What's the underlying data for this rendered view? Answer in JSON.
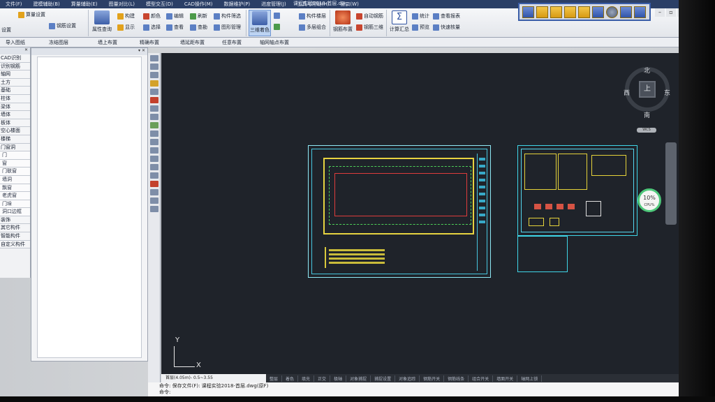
{
  "menu": {
    "items": [
      "文件(F)",
      "建模辅助(B)",
      "算量辅助(E)",
      "图量对比(L)",
      "模型交互(D)",
      "CAD操作(M)",
      "数据维护(P)",
      "进度管理(J)",
      "工具与帮助(H)",
      "窗口(W)"
    ],
    "file_title": "课程实验2018-首层.dwg"
  },
  "ribbon": {
    "buttons": [
      "算量设置",
      "钢筋设置",
      "属性查询",
      "构建",
      "显示",
      "颜色",
      "选择",
      "编辑",
      "查看",
      "刷新",
      "查勘",
      "构件筛选",
      "图形管理",
      "三维着色",
      "构件楼层",
      "多层组合",
      "钢筋布置",
      "自动钢筋",
      "钢筋三维",
      "计算汇总",
      "统计",
      "预览",
      "查看报表",
      "快速核量"
    ],
    "big_labels": {
      "attr": "属性查询",
      "color3d": "三维着色",
      "rebar": "钢筋布置",
      "calc": "计算汇总"
    },
    "left_label": "设置"
  },
  "toolrow": {
    "items": [
      "导入图纸",
      "冻结图层",
      "墙上布置",
      "精确布置",
      "墙延距布置",
      "任意布置",
      "轴网轴点布置"
    ]
  },
  "leftnav": {
    "items": [
      "CAD识别",
      "识别钢筋",
      "轴网",
      "土方",
      "基础",
      "柱体",
      "梁体",
      "墙体",
      "板体",
      "空心楼面",
      "楼梯",
      "门窗洞"
    ],
    "subitems": [
      "门",
      "窗",
      "门联窗",
      "墙洞",
      "飘窗",
      "老虎窗",
      "门垛",
      "洞口边框",
      "装饰",
      "其它构件",
      "智能构件",
      "自定义构件"
    ]
  },
  "compass": {
    "north": "北",
    "south": "南",
    "east": "东",
    "west": "西",
    "center": "上",
    "pill": "WCS"
  },
  "zoom_badge": {
    "value": "10%",
    "label": "CPU%"
  },
  "ucs": {
    "x": "X",
    "y": "Y"
  },
  "status": {
    "layer": "首层(4.05m)- 0.5~3.55",
    "toggles": [
      "整层",
      "着色",
      "填充",
      "正交",
      "极轴",
      "对象捕捉",
      "捕捉设置",
      "对象追踪",
      "钢筋开关",
      "钢筋线条",
      "组合开关",
      "墙面开关",
      "轴网上锁",
      "轴网上锁"
    ]
  },
  "command": {
    "line1": "命令: 保存文件(F): 课程实验2018-首层.dwg(原F)",
    "line2": "命令:"
  }
}
